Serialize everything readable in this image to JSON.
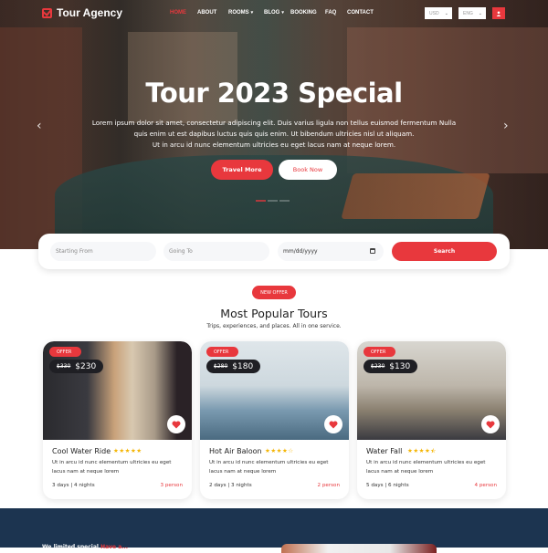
{
  "brand": {
    "name": "Tour Agency",
    "icon": "checkbox-icon"
  },
  "nav": {
    "items": [
      {
        "label": "HOME",
        "active": true,
        "dropdown": false
      },
      {
        "label": "ABOUT",
        "active": false,
        "dropdown": false
      },
      {
        "label": "ROOMS",
        "active": false,
        "dropdown": true
      },
      {
        "label": "BLOG",
        "active": false,
        "dropdown": true
      },
      {
        "label": "BOOKING",
        "active": false,
        "dropdown": false
      },
      {
        "label": "FAQ",
        "active": false,
        "dropdown": false
      },
      {
        "label": "CONTACT",
        "active": false,
        "dropdown": false
      }
    ],
    "currency": "USD",
    "language": "ENG",
    "user_icon": "user-icon"
  },
  "hero": {
    "title": "Tour 2023 Special",
    "description_lines": [
      "Lorem ipsum dolor sit amet, consectetur adipiscing elit. Duis varius ligula non tellus euismod fermentum Nulla",
      "quis enim ut est dapibus luctus quis quis enim. Ut bibendum ultricies nisl ut aliquam.",
      "Ut in arcu id nunc elementum ultricies eu eget lacus nam at neque lorem."
    ],
    "primary_button": "Travel More",
    "secondary_button": "Book Now",
    "slides": 3,
    "active_slide": 1,
    "prev_arrow": "‹",
    "next_arrow": "›"
  },
  "search": {
    "from_placeholder": "Starting From",
    "to_placeholder": "Going To",
    "date_placeholder": "mm/dd/yyyy",
    "button": "Search"
  },
  "section": {
    "badge": "NEW OFFER",
    "title": "Most Popular Tours",
    "subtitle": "Trips, experiences, and places. All in one service."
  },
  "tours": [
    {
      "name": "Cool Water Ride",
      "offer": "OFFER",
      "old_price": "$330",
      "price": "$230",
      "rating": 5,
      "stars": "★★★★★",
      "description": "Ut in arcu id nunc elementum ultricies eu eget lacus nam at neque lorem",
      "duration": "3 days | 4 nights",
      "persons": "3 person"
    },
    {
      "name": "Hot Air Baloon",
      "offer": "OFFER",
      "old_price": "$280",
      "price": "$180",
      "rating": 4,
      "stars": "★★★★☆",
      "description": "Ut in arcu id nunc elementum ultricies eu eget lacus nam at neque lorem",
      "duration": "2 days | 3 nights",
      "persons": "2 person"
    },
    {
      "name": "Water Fall",
      "offer": "OFFER",
      "old_price": "$230",
      "price": "$130",
      "rating": 4.5,
      "stars": "★★★★⯪",
      "description": "Ut in arcu id nunc elementum ultricies eu eget lacus nam at neque lorem",
      "duration": "5 days | 6 nights",
      "persons": "4 person"
    }
  ],
  "bottom": {
    "text": "We limited special ",
    "highlight": "Have a..."
  },
  "colors": {
    "accent": "#e8383d",
    "dark": "#1f1f24",
    "navy": "#1c3450",
    "star": "#f4b400"
  }
}
